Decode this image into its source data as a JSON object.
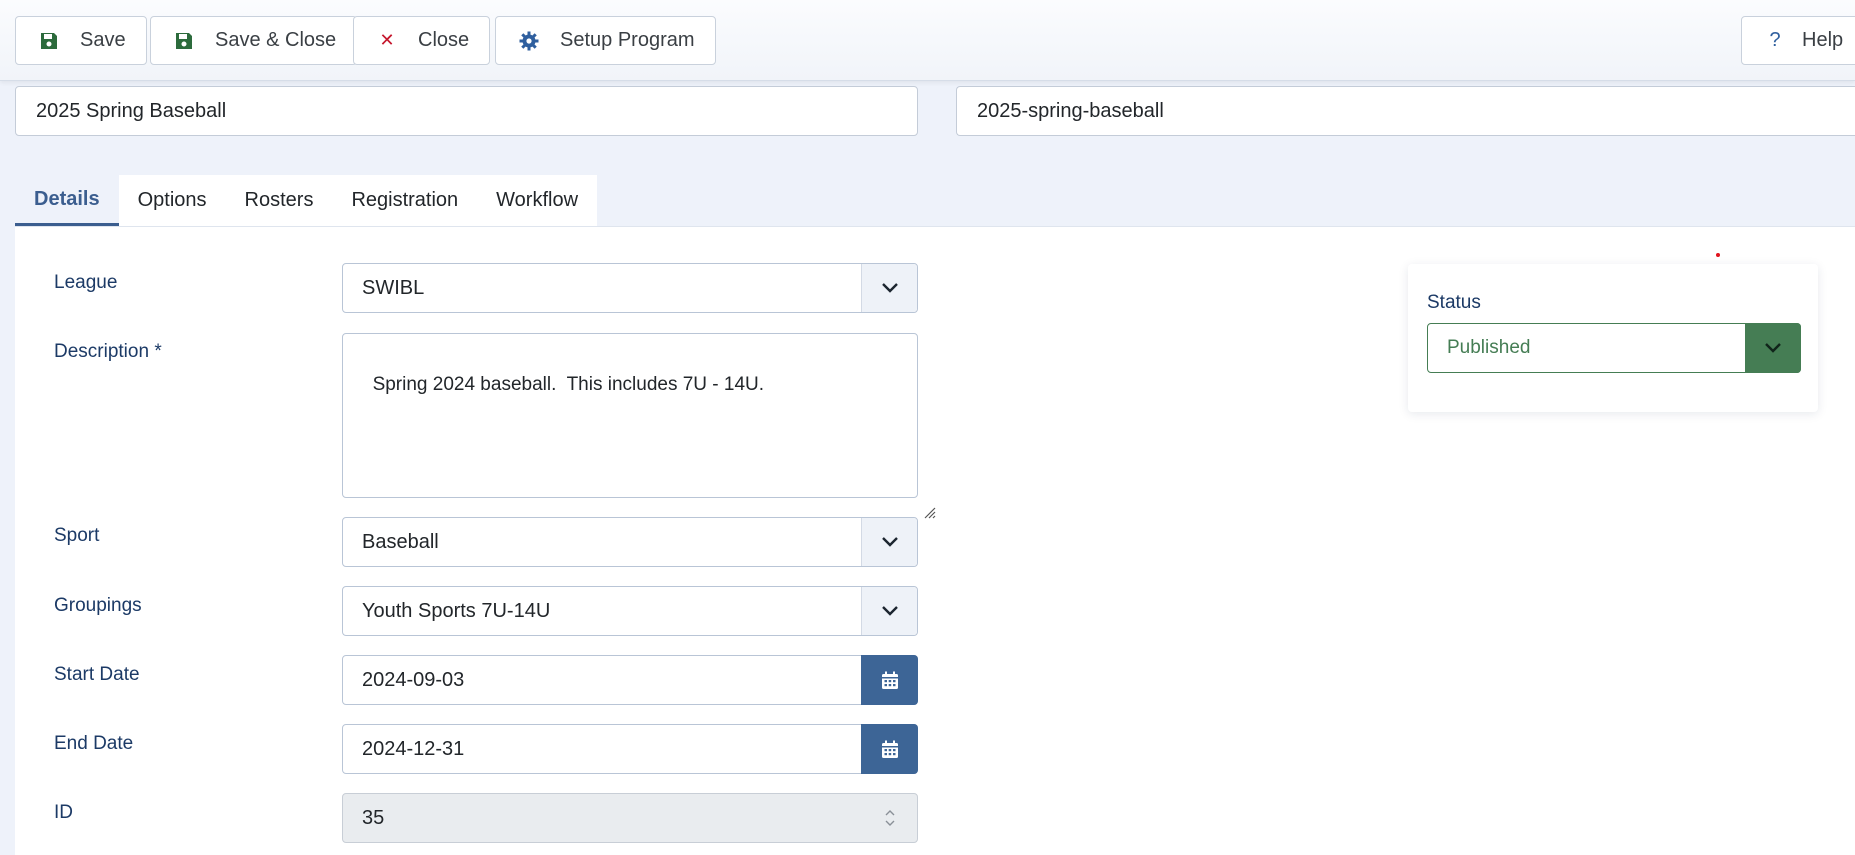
{
  "toolbar": {
    "save_label": "Save",
    "save_close_label": "Save & Close",
    "close_label": "Close",
    "setup_program_label": "Setup Program",
    "help_label": "Help",
    "help_glyph": "?",
    "close_glyph": "✕"
  },
  "title": {
    "name_value": "2025 Spring Baseball",
    "alias_value": "2025-spring-baseball"
  },
  "tabs": [
    {
      "label": "Details",
      "active": true
    },
    {
      "label": "Options",
      "active": false
    },
    {
      "label": "Rosters",
      "active": false
    },
    {
      "label": "Registration",
      "active": false
    },
    {
      "label": "Workflow",
      "active": false
    }
  ],
  "form": {
    "league": {
      "label": "League",
      "value": "SWIBL"
    },
    "description": {
      "label": "Description *",
      "value": "Spring 2024 baseball.  This includes 7U - 14U."
    },
    "sport": {
      "label": "Sport",
      "value": "Baseball"
    },
    "groupings": {
      "label": "Groupings",
      "value": "Youth Sports 7U-14U"
    },
    "start_date": {
      "label": "Start Date",
      "value": "2024-09-03"
    },
    "end_date": {
      "label": "End Date",
      "value": "2024-12-31"
    },
    "id": {
      "label": "ID",
      "value": "35"
    }
  },
  "status": {
    "label": "Status",
    "value": "Published"
  },
  "icons": {
    "save": "floppy-disk-icon",
    "close": "x-icon",
    "setup": "gear-icon",
    "help": "question-icon",
    "dropdown": "chevron-down-icon",
    "calendar": "calendar-icon"
  },
  "colors": {
    "accent_blue": "#3d6596",
    "status_green": "#457d54",
    "close_red": "#c5162c",
    "save_green": "#2c6b3c",
    "gear_blue": "#2f5f9e"
  }
}
